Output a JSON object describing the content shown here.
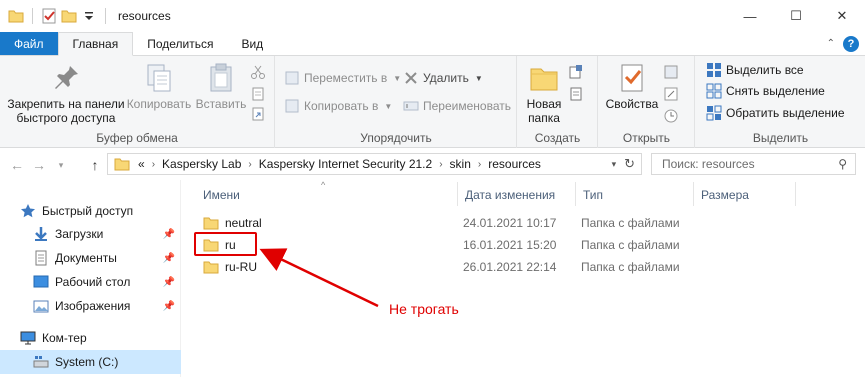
{
  "window": {
    "title": "resources",
    "controls": {
      "minimize": "—",
      "maximize": "☐",
      "close": "✕"
    }
  },
  "tabs": [
    {
      "label": "Файл"
    },
    {
      "label": "Главная"
    },
    {
      "label": "Поделиться"
    },
    {
      "label": "Вид"
    }
  ],
  "ribbon": {
    "clipboard": {
      "label": "Буфер обмена",
      "pin": "Закрепить на панели быстрого доступа",
      "copy": "Копировать",
      "paste": "Вставить"
    },
    "organize": {
      "label": "Упорядочить",
      "move_to": "Переместить в",
      "copy_to": "Копировать в",
      "delete": "Удалить",
      "rename": "Переименовать"
    },
    "new": {
      "label": "Создать",
      "new_folder": "Новая папка"
    },
    "open": {
      "label": "Открыть",
      "properties": "Свойства"
    },
    "select": {
      "label": "Выделить",
      "select_all": "Выделить все",
      "select_none": "Снять выделение",
      "invert": "Обратить выделение"
    }
  },
  "address": {
    "overflow": "«",
    "crumbs": [
      "Kaspersky Lab",
      "Kaspersky Internet Security 21.2",
      "skin",
      "resources"
    ],
    "search_placeholder": "Поиск: resources"
  },
  "nav": {
    "items": [
      {
        "label": "Быстрый доступ"
      },
      {
        "label": "Загрузки"
      },
      {
        "label": "Документы"
      },
      {
        "label": "Рабочий стол"
      },
      {
        "label": "Изображения"
      },
      {
        "label": "Ком-тер"
      },
      {
        "label": "System (C:)"
      }
    ]
  },
  "columns": {
    "name": "Имени",
    "date": "Дата изменения",
    "type": "Тип",
    "size": "Размера"
  },
  "files": [
    {
      "name": "neutral",
      "date": "24.01.2021 10:17",
      "type": "Папка с файлами"
    },
    {
      "name": "ru",
      "date": "16.01.2021 15:20",
      "type": "Папка с файлами"
    },
    {
      "name": "ru-RU",
      "date": "26.01.2021 22:14",
      "type": "Папка с файлами"
    }
  ],
  "annotation": {
    "text": "Не трогать",
    "color": "#e00000"
  },
  "colors": {
    "accent": "#1979ca",
    "folder": "#f8d775",
    "selection": "#cce8ff"
  }
}
